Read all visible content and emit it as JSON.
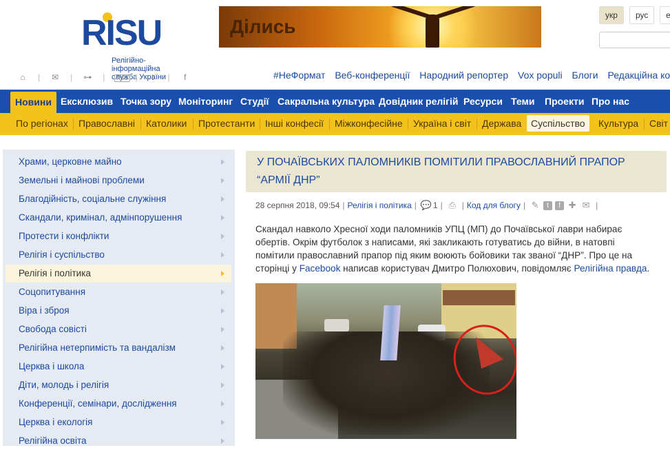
{
  "header": {
    "logo_text": "RISU",
    "logo_subtitle_1": "Релігійно-інформаційна",
    "logo_subtitle_2": "служба України",
    "banner_text": "Ділись",
    "languages": [
      "укр",
      "рус",
      "e"
    ],
    "active_language": "укр",
    "social_icons": [
      "home-icon",
      "mail-icon",
      "sitemap-icon",
      "rss-icon",
      "twitter-icon",
      "facebook-icon"
    ],
    "rss_label": "RSS",
    "top_links": [
      "#НеФормат",
      "Веб-конференції",
      "Народний репортер",
      "Vox populi",
      "Блоги",
      "Редакційна коле"
    ]
  },
  "main_nav": [
    "Новини",
    "Ексклюзив",
    "Точка зору",
    "Моніторинг",
    "Студії",
    "Сакральна культура",
    "Довідник релігій",
    "Ресурси",
    "Теми",
    "Проекти",
    "Про нас"
  ],
  "sub_nav": [
    "По регіонах",
    "Православні",
    "Католики",
    "Протестанти",
    "Інші конфесії",
    "Міжконфесійне",
    "Україна і світ",
    "Держава",
    "Суспільство",
    "Культура",
    "Світ"
  ],
  "sidebar": [
    "Храми, церковне майно",
    "Земельні і майнові проблеми",
    "Благодійність, соціальне служіння",
    "Скандали, кримінал, адмінпорушення",
    "Протести і конфлікти",
    "Релігія і суспільство",
    "Релігія і політика",
    "Соцопитування",
    "Віра і зброя",
    "Свобода совісті",
    "Релігійна нетерпимість та вандалізм",
    "Церква і школа",
    "Діти, молодь і релігія",
    "Конференції, семінари, дослідження",
    "Церква і екологія",
    "Релігійна освіта"
  ],
  "article": {
    "title": "У почаївських паломників помітили православний прапор “армії ДНР”",
    "date": "28 серпня 2018, 09:54",
    "category": "Релігія і політика",
    "comments": "1",
    "blog_code": "Код для блогу",
    "body_1": "Скандал навколо Хресної ходи паломників УПЦ (МП) до Почаївської лаври набирає обертів. Окрім футболок з написами, які закликають готуватись до війни, в натовпі помітили православний прапор під яким воюють бойовики так званої “ДНР”. Про це на сторінці у ",
    "body_link_1": "Facebook",
    "body_2": " написав користувач Дмитро Полюхович, повідомляє ",
    "body_link_2": "Релігійна правда",
    "body_3": "."
  }
}
